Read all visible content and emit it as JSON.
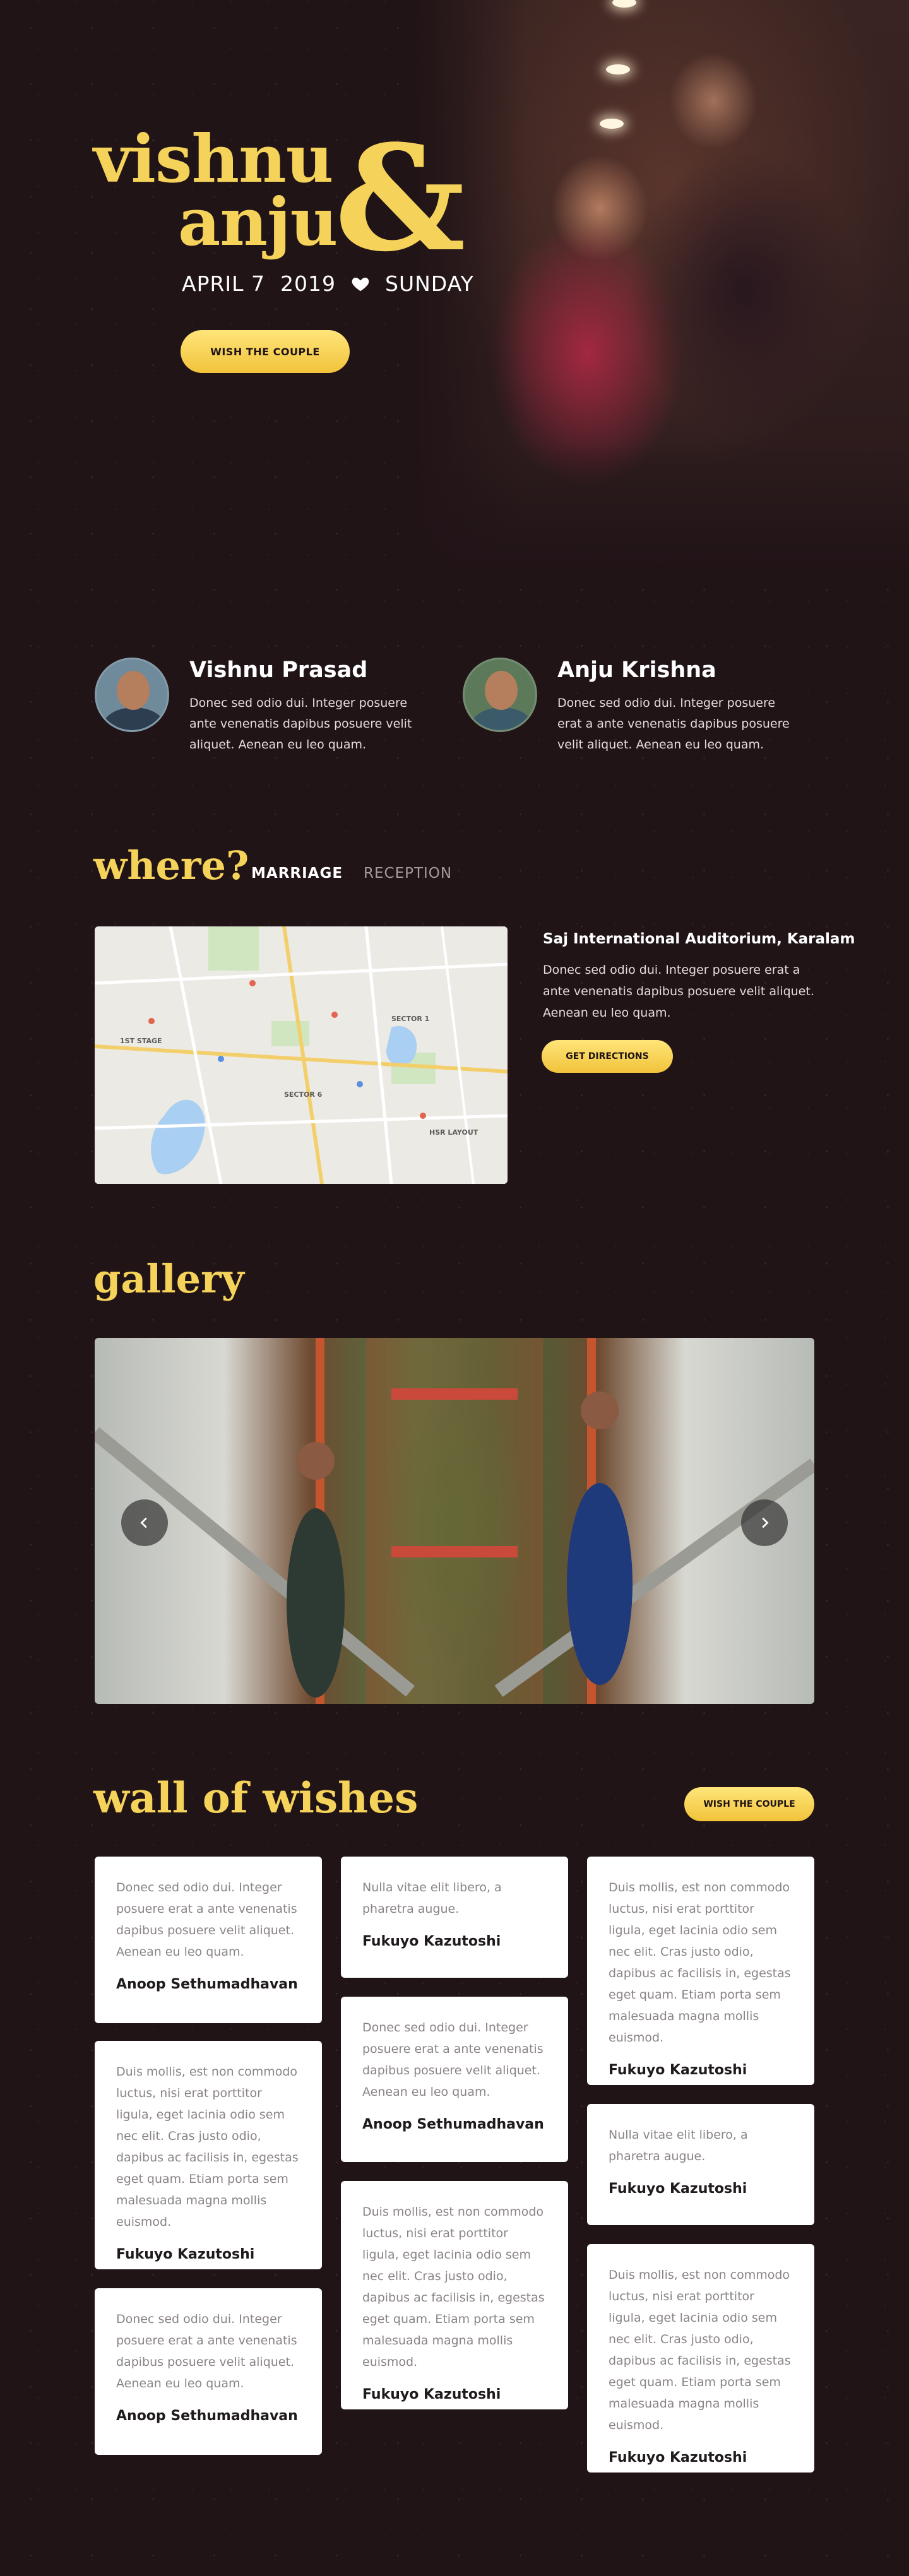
{
  "hero": {
    "name1": "vishnu",
    "name2": "anju",
    "ampersand": "&",
    "date_day": "APRIL 7",
    "date_year": "2019",
    "date_weekday": "SUNDAY",
    "cta": "WISH THE COUPLE"
  },
  "profiles": [
    {
      "name": "Vishnu Prasad",
      "desc": "Donec sed odio dui. Integer posuere ante venenatis dapibus posuere velit aliquet. Aenean eu leo quam."
    },
    {
      "name": "Anju Krishna",
      "desc": "Donec sed odio dui. Integer posuere erat a ante venenatis dapibus posuere velit aliquet. Aenean eu leo quam."
    }
  ],
  "where": {
    "title": "where?",
    "tabs": [
      "MARRIAGE",
      "RECEPTION"
    ],
    "venue_name": "Saj International Auditorium, Karalam",
    "venue_desc": "Donec sed odio dui. Integer posuere erat a ante venenatis dapibus posuere velit aliquet. Aenean eu leo quam.",
    "directions_label": "GET DIRECTIONS",
    "map_labels": [
      "1ST STAGE",
      "SECTOR 6",
      "SECTOR 1",
      "HSR LAYOUT"
    ]
  },
  "gallery": {
    "title": "gallery"
  },
  "wishes": {
    "title": "wall of wishes",
    "cta": "WISH THE COUPLE",
    "columns": [
      [
        {
          "text": "Donec sed odio dui. Integer posuere erat a ante venenatis dapibus posuere velit aliquet. Aenean eu leo quam.",
          "author": "Anoop Sethumadhavan"
        },
        {
          "text": "Duis mollis, est non commodo luctus, nisi erat porttitor ligula, eget lacinia odio sem nec elit. Cras justo odio, dapibus ac facilisis in, egestas eget quam. Etiam porta sem malesuada magna mollis euismod.",
          "author": "Fukuyo Kazutoshi"
        },
        {
          "text": "Donec sed odio dui. Integer posuere erat a ante venenatis dapibus posuere velit aliquet. Aenean eu leo quam.",
          "author": "Anoop Sethumadhavan"
        }
      ],
      [
        {
          "text": "Nulla vitae elit libero, a pharetra augue.",
          "author": "Fukuyo Kazutoshi"
        },
        {
          "text": "Donec sed odio dui. Integer posuere erat a ante venenatis dapibus posuere velit aliquet. Aenean eu leo quam.",
          "author": "Anoop Sethumadhavan"
        },
        {
          "text": "Duis mollis, est non commodo luctus, nisi erat porttitor ligula, eget lacinia odio sem nec elit. Cras justo odio, dapibus ac facilisis in, egestas eget quam. Etiam porta sem malesuada magna mollis euismod.",
          "author": "Fukuyo Kazutoshi"
        }
      ],
      [
        {
          "text": "Duis mollis, est non commodo luctus, nisi erat porttitor ligula, eget lacinia odio sem nec elit. Cras justo odio, dapibus ac facilisis in, egestas eget quam. Etiam porta sem malesuada magna mollis euismod.",
          "author": "Fukuyo Kazutoshi"
        },
        {
          "text": "Nulla vitae elit libero, a pharetra augue.",
          "author": "Fukuyo Kazutoshi"
        },
        {
          "text": "Duis mollis, est non commodo luctus, nisi erat porttitor ligula, eget lacinia odio sem nec elit. Cras justo odio, dapibus ac facilisis in, egestas eget quam. Etiam porta sem malesuada magna mollis euismod.",
          "author": "Fukuyo Kazutoshi"
        }
      ]
    ]
  },
  "colors": {
    "background": "#211417",
    "accent_gold": "#f5d25a",
    "card": "#ffffff"
  },
  "icons": [
    "heart-icon",
    "chevron-left-icon",
    "chevron-right-icon"
  ]
}
